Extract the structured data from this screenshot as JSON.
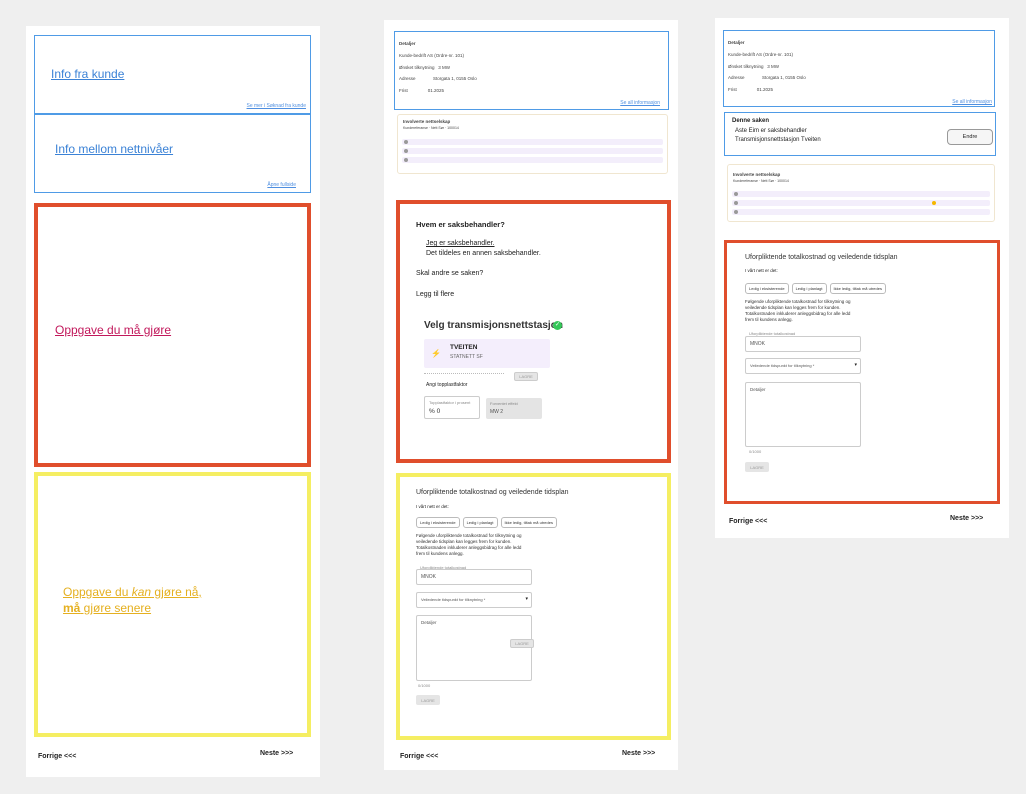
{
  "col1": {
    "info_fra_kunde": "Info fra kunde",
    "se_mer_link": "Se mer i Søknad fra kunde",
    "info_mellom": "Info mellom nettnivåer",
    "apne_link": "Åpne fullside",
    "oppgave_ma": "Oppgave du må gjøre ",
    "oppgave_kan_1": "Oppgave du ",
    "oppgave_kan_em": "kan",
    "oppgave_kan_2": " gjøre nå,",
    "oppgave_ma_strong": "må",
    "oppgave_kan_3": " gjøre senere ",
    "forrige": "Forrige <<<",
    "neste": "Neste >>>"
  },
  "col2": {
    "details_title": "Detaljer",
    "details_lines": [
      "Kunde-bedrift AS (Ordre-nr. 101)",
      "Ønsket tilknytning   3 MW",
      "Adresse              Storgata 1, 0155 Oslo",
      "Frist                01.2025"
    ],
    "se_alle_link": "Se all informasjon",
    "involverte_title": "Involverte nettselskap",
    "involverte_sub": "Kundereferanse  ·  Nett Sør  ·  100014",
    "question": "Hvem er saksbehandler?",
    "option1": "Jeg er saksbehandler.",
    "option2": "Det tildeles en annen saksbehandler.",
    "skal_andre": "Skal andre se saken?",
    "legg_til": "Legg til flere",
    "velg_title": "Velg transmisjonsnettstasjon",
    "station_name": "TVEITEN",
    "station_owner": "STATNETT SF",
    "lagre": "LAGRE",
    "angi": "Angi topplastfaktor",
    "topplast_label": "Topplastfaktor i prosent",
    "topplast_val": "% 0",
    "forventet_label": "Forventet effekt",
    "forventet_val": "MW  2",
    "uforpliktende_title": "Uforpliktende totalkostnad og veiledende tidsplan",
    "i_vart": "I vårt nett er det:",
    "chips": [
      "Ledig i eksisterende",
      "Ledig i planlagt",
      "Ikke ledig, tiltak må utredes"
    ],
    "desc": [
      "Følgende uforpliktende totalkostnad for tilknytning og",
      "veiledende tidsplan kan legges frem for kunden.",
      "Totalkostnaden inkluderer anleggsbidrag for alle ledd",
      "frem til kundens anlegg."
    ],
    "kostnad_label": "Uforpliktende totalkostnad",
    "kostnad_val": "MNOK",
    "tidspunkt": "Veiledende tidspunkt for tilknytning *",
    "detaljer": "Detaljer",
    "counter": "0/1000",
    "lagre2": "LAGRE",
    "forrige": "Forrige <<<",
    "neste": "Neste >>>"
  },
  "col3": {
    "details_title": "Detaljer",
    "details_lines": [
      "Kunde-bedrift AS (Ordre-nr. 101)",
      "Ønsket tilknytning   3 MW",
      "Adresse              Storgata 1, 0155 Oslo",
      "Frist                01.2025"
    ],
    "se_alle_link": "Se all informasjon",
    "denne_title": "Denne saken",
    "denne_line1": "Aste Eim er saksbehandler",
    "denne_line2": "Transmisjonsnettstasjon Tveiten",
    "endre": "Endre",
    "involverte_title": "Involverte nettselskap",
    "involverte_sub": "Kundereferanse  ·  Nett Sør  ·  100014",
    "uforpliktende_title": "Uforpliktende totalkostnad og veiledende tidsplan",
    "i_vart": "I vårt nett er det:",
    "chips": [
      "Ledig i eksisterende",
      "Ledig i planlagt",
      "Ikke ledig, tiltak må utredes"
    ],
    "desc": [
      "Følgende uforpliktende totalkostnad for tilknytning og",
      "veiledende tidsplan kan legges frem for kunden.",
      "Totalkostnaden inkluderer anleggsbidrag for alle ledd",
      "frem til kundens anlegg."
    ],
    "kostnad_label": "Uforpliktende totalkostnad",
    "kostnad_val": "MNOK",
    "tidspunkt": "Veiledende tidspunkt for tilknytning *",
    "detaljer": "Detaljer",
    "counter": "0/1000",
    "lagre": "LAGRE",
    "forrige": "Forrige <<<",
    "neste": "Neste >>>"
  },
  "colors": {
    "blue": "#4f9be6",
    "red": "#e04e2c",
    "yellow": "#f5ee62",
    "magenta": "#c2185b",
    "gold": "#e5b020"
  }
}
